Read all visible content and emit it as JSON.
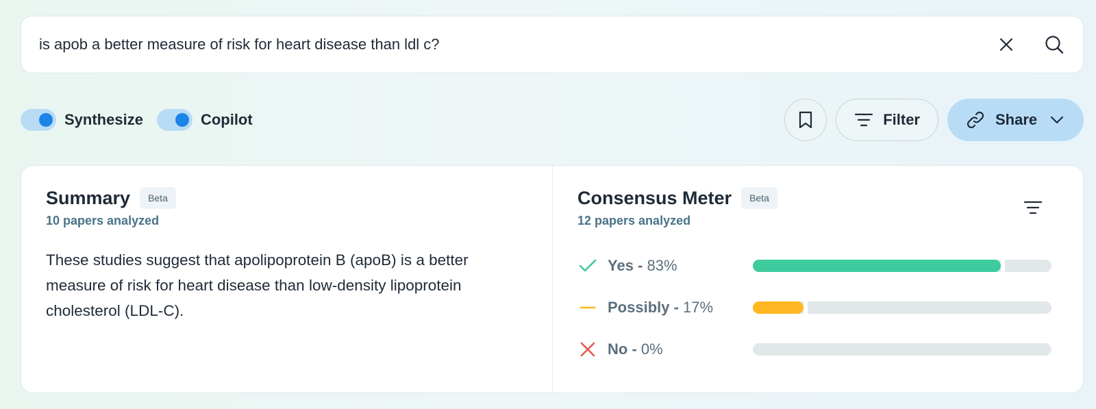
{
  "search": {
    "value": "is apob a better measure of risk for heart disease than ldl c?",
    "clear_icon": "close-icon",
    "search_icon": "search-icon"
  },
  "toggles": [
    {
      "label": "Synthesize",
      "on": true
    },
    {
      "label": "Copilot",
      "on": true
    }
  ],
  "actions": {
    "bookmark_icon": "bookmark-icon",
    "filter_label": "Filter",
    "share_label": "Share"
  },
  "summary": {
    "title": "Summary",
    "badge": "Beta",
    "papers": "10 papers analyzed",
    "text": "These studies suggest that apolipoprotein B (apoB) is a better measure of risk for heart disease than low-density lipoprotein cholesterol (LDL-C)."
  },
  "consensus": {
    "title": "Consensus Meter",
    "badge": "Beta",
    "papers": "12 papers analyzed",
    "rows": [
      {
        "label": "Yes",
        "pct_text": "83%",
        "fraction": 0.83,
        "color": "#3ecb9e",
        "icon": "check-icon"
      },
      {
        "label": "Possibly",
        "pct_text": "17%",
        "fraction": 0.17,
        "color": "#ffb821",
        "icon": "dash-icon"
      },
      {
        "label": "No",
        "pct_text": "0%",
        "fraction": 0.0,
        "color": "#e45a4f",
        "icon": "x-icon"
      }
    ]
  },
  "colors": {
    "accent": "#1b84e8",
    "toggle_track": "#b9dcf6",
    "share_bg": "#b8dcf6",
    "muted_text": "#4a7388"
  }
}
